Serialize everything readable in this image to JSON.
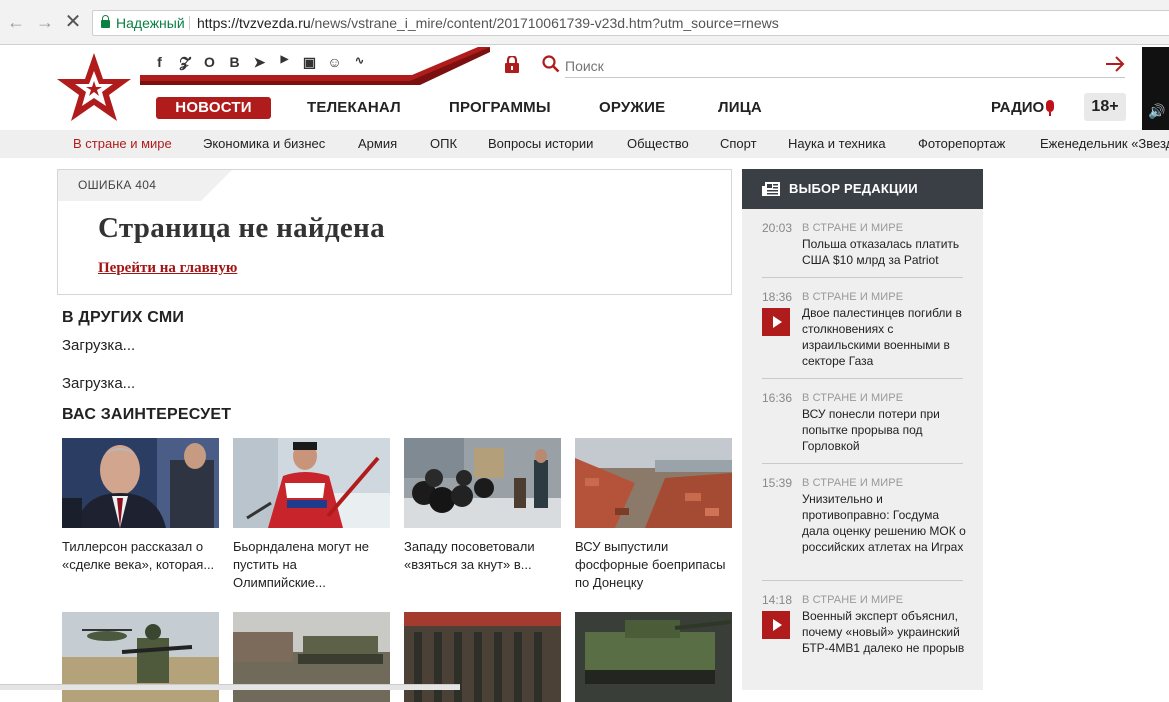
{
  "browser": {
    "secure_label": "Надежный",
    "url_host": "https://tvzvezda.ru",
    "url_path": "/news/vstrane_i_mire/content/201710061739-v23d.htm?utm_source=rnews"
  },
  "header": {
    "search_placeholder": "Поиск",
    "nav": [
      "НОВОСТИ",
      "ТЕЛЕКАНАЛ",
      "ПРОГРАММЫ",
      "ОРУЖИЕ",
      "ЛИЦА"
    ],
    "radio_label": "РАДИО",
    "age_label": "18+",
    "social_icons": [
      "facebook-icon",
      "twitter-icon",
      "odnoklassniki-icon",
      "vk-icon",
      "telegram-icon",
      "youtube-icon",
      "instagram-icon",
      "yandex-zen-icon",
      "rss-icon"
    ]
  },
  "subnav": [
    "В стране и мире",
    "Экономика и бизнес",
    "Армия",
    "ОПК",
    "Вопросы истории",
    "Общество",
    "Спорт",
    "Наука и техника",
    "Фоторепортаж",
    "Еженедельник «Звезда»"
  ],
  "error": {
    "tag": "ОШИБКА 404",
    "title": "Страница не найдена",
    "link": "Перейти на главную"
  },
  "other_media": {
    "title": "В ДРУГИХ СМИ",
    "loading1": "Загрузка...",
    "loading2": "Загрузка..."
  },
  "interest": {
    "title": "ВАС ЗАИНТЕРЕСУЕТ",
    "cards": [
      {
        "title": "Тиллерсон рассказал о «сделке века», которая..."
      },
      {
        "title": "Бьорндалена могут не пустить на Олимпийские..."
      },
      {
        "title": "Западу посоветовали «взяться за кнут» в..."
      },
      {
        "title": "ВСУ выпустили фосфорные боеприпасы по Донецку"
      }
    ]
  },
  "sidebar": {
    "title": "ВЫБОР РЕДАКЦИИ",
    "items": [
      {
        "time": "20:03",
        "category": "В СТРАНЕ И МИРЕ",
        "title": "Польша отказалась платить США $10 млрд за Patriot",
        "video": false
      },
      {
        "time": "18:36",
        "category": "В СТРАНЕ И МИРЕ",
        "title": "Двое палестинцев погибли в столкновениях с израильскими военными в секторе Газа",
        "video": true
      },
      {
        "time": "16:36",
        "category": "В СТРАНЕ И МИРЕ",
        "title": "ВСУ понесли потери при попытке прорыва под Горловкой",
        "video": false
      },
      {
        "time": "15:39",
        "category": "В СТРАНЕ И МИРЕ",
        "title": "Унизительно и противоправно: Госдума дала оценку решению МОК о российских атлетах на Играх",
        "video": false
      },
      {
        "time": "14:18",
        "category": "В СТРАНЕ И МИРЕ",
        "title": "Военный эксперт объяснил, почему «новый» украинский БТР-4МВ1 далеко не прорыв",
        "video": true
      }
    ]
  },
  "colors": {
    "brand_red": "#b01c1c",
    "sidebar_head": "#3a3e45",
    "secure_green": "#0b8043"
  }
}
